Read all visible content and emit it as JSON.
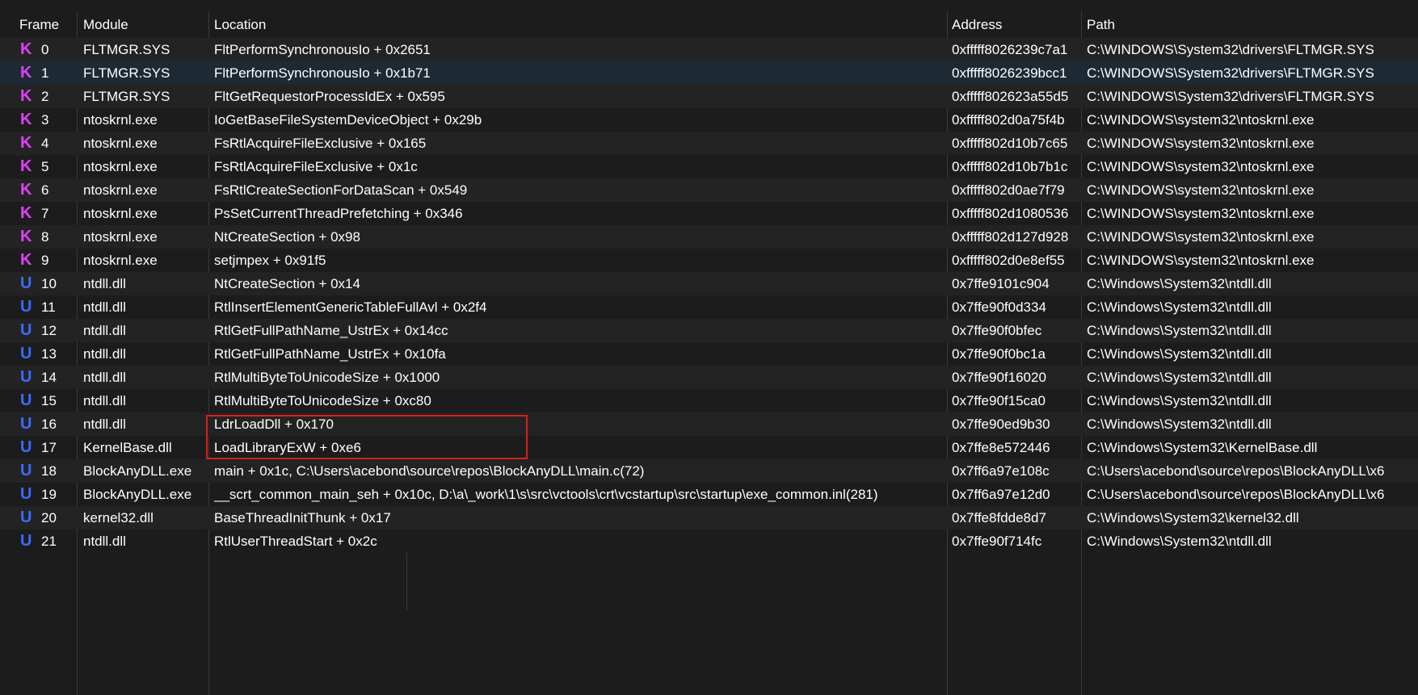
{
  "columns": {
    "frame": "Frame",
    "module": "Module",
    "location": "Location",
    "address": "Address",
    "path": "Path"
  },
  "colors": {
    "kernel_icon": "#e040fb",
    "user_icon": "#3b6bff",
    "highlight_border": "#d9201c",
    "background": "#1c1c1c"
  },
  "rows": [
    {
      "icon": "K",
      "frame": "0",
      "module": "FLTMGR.SYS",
      "location": "FltPerformSynchronousIo + 0x2651",
      "address": "0xfffff8026239c7a1",
      "path": "C:\\WINDOWS\\System32\\drivers\\FLTMGR.SYS"
    },
    {
      "icon": "K",
      "frame": "1",
      "module": "FLTMGR.SYS",
      "location": "FltPerformSynchronousIo + 0x1b71",
      "address": "0xfffff8026239bcc1",
      "path": "C:\\WINDOWS\\System32\\drivers\\FLTMGR.SYS"
    },
    {
      "icon": "K",
      "frame": "2",
      "module": "FLTMGR.SYS",
      "location": "FltGetRequestorProcessIdEx + 0x595",
      "address": "0xfffff802623a55d5",
      "path": "C:\\WINDOWS\\System32\\drivers\\FLTMGR.SYS"
    },
    {
      "icon": "K",
      "frame": "3",
      "module": "ntoskrnl.exe",
      "location": "IoGetBaseFileSystemDeviceObject + 0x29b",
      "address": "0xfffff802d0a75f4b",
      "path": "C:\\WINDOWS\\system32\\ntoskrnl.exe"
    },
    {
      "icon": "K",
      "frame": "4",
      "module": "ntoskrnl.exe",
      "location": "FsRtlAcquireFileExclusive + 0x165",
      "address": "0xfffff802d10b7c65",
      "path": "C:\\WINDOWS\\system32\\ntoskrnl.exe"
    },
    {
      "icon": "K",
      "frame": "5",
      "module": "ntoskrnl.exe",
      "location": "FsRtlAcquireFileExclusive + 0x1c",
      "address": "0xfffff802d10b7b1c",
      "path": "C:\\WINDOWS\\system32\\ntoskrnl.exe"
    },
    {
      "icon": "K",
      "frame": "6",
      "module": "ntoskrnl.exe",
      "location": "FsRtlCreateSectionForDataScan + 0x549",
      "address": "0xfffff802d0ae7f79",
      "path": "C:\\WINDOWS\\system32\\ntoskrnl.exe"
    },
    {
      "icon": "K",
      "frame": "7",
      "module": "ntoskrnl.exe",
      "location": "PsSetCurrentThreadPrefetching + 0x346",
      "address": "0xfffff802d1080536",
      "path": "C:\\WINDOWS\\system32\\ntoskrnl.exe"
    },
    {
      "icon": "K",
      "frame": "8",
      "module": "ntoskrnl.exe",
      "location": "NtCreateSection + 0x98",
      "address": "0xfffff802d127d928",
      "path": "C:\\WINDOWS\\system32\\ntoskrnl.exe"
    },
    {
      "icon": "K",
      "frame": "9",
      "module": "ntoskrnl.exe",
      "location": "setjmpex + 0x91f5",
      "address": "0xfffff802d0e8ef55",
      "path": "C:\\WINDOWS\\system32\\ntoskrnl.exe"
    },
    {
      "icon": "U",
      "frame": "10",
      "module": "ntdll.dll",
      "location": "NtCreateSection + 0x14",
      "address": "0x7ffe9101c904",
      "path": "C:\\Windows\\System32\\ntdll.dll"
    },
    {
      "icon": "U",
      "frame": "11",
      "module": "ntdll.dll",
      "location": "RtlInsertElementGenericTableFullAvl + 0x2f4",
      "address": "0x7ffe90f0d334",
      "path": "C:\\Windows\\System32\\ntdll.dll"
    },
    {
      "icon": "U",
      "frame": "12",
      "module": "ntdll.dll",
      "location": "RtlGetFullPathName_UstrEx + 0x14cc",
      "address": "0x7ffe90f0bfec",
      "path": "C:\\Windows\\System32\\ntdll.dll"
    },
    {
      "icon": "U",
      "frame": "13",
      "module": "ntdll.dll",
      "location": "RtlGetFullPathName_UstrEx + 0x10fa",
      "address": "0x7ffe90f0bc1a",
      "path": "C:\\Windows\\System32\\ntdll.dll"
    },
    {
      "icon": "U",
      "frame": "14",
      "module": "ntdll.dll",
      "location": "RtlMultiByteToUnicodeSize + 0x1000",
      "address": "0x7ffe90f16020",
      "path": "C:\\Windows\\System32\\ntdll.dll"
    },
    {
      "icon": "U",
      "frame": "15",
      "module": "ntdll.dll",
      "location": "RtlMultiByteToUnicodeSize + 0xc80",
      "address": "0x7ffe90f15ca0",
      "path": "C:\\Windows\\System32\\ntdll.dll"
    },
    {
      "icon": "U",
      "frame": "16",
      "module": "ntdll.dll",
      "location": "LdrLoadDll + 0x170",
      "address": "0x7ffe90ed9b30",
      "path": "C:\\Windows\\System32\\ntdll.dll"
    },
    {
      "icon": "U",
      "frame": "17",
      "module": "KernelBase.dll",
      "location": "LoadLibraryExW + 0xe6",
      "address": "0x7ffe8e572446",
      "path": "C:\\Windows\\System32\\KernelBase.dll"
    },
    {
      "icon": "U",
      "frame": "18",
      "module": "BlockAnyDLL.exe",
      "location": "main + 0x1c, C:\\Users\\acebond\\source\\repos\\BlockAnyDLL\\main.c(72)",
      "address": "0x7ff6a97e108c",
      "path": "C:\\Users\\acebond\\source\\repos\\BlockAnyDLL\\x6"
    },
    {
      "icon": "U",
      "frame": "19",
      "module": "BlockAnyDLL.exe",
      "location": "__scrt_common_main_seh + 0x10c, D:\\a\\_work\\1\\s\\src\\vctools\\crt\\vcstartup\\src\\startup\\exe_common.inl(281)",
      "address": "0x7ff6a97e12d0",
      "path": "C:\\Users\\acebond\\source\\repos\\BlockAnyDLL\\x6"
    },
    {
      "icon": "U",
      "frame": "20",
      "module": "kernel32.dll",
      "location": "BaseThreadInitThunk + 0x17",
      "address": "0x7ffe8fdde8d7",
      "path": "C:\\Windows\\System32\\kernel32.dll"
    },
    {
      "icon": "U",
      "frame": "21",
      "module": "ntdll.dll",
      "location": "RtlUserThreadStart + 0x2c",
      "address": "0x7ffe90f714fc",
      "path": "C:\\Windows\\System32\\ntdll.dll"
    }
  ]
}
